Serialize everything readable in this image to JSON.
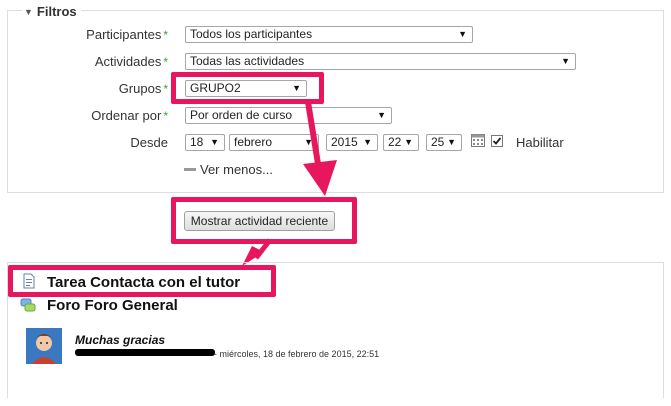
{
  "filters": {
    "legend": "Filtros",
    "participants_label": "Participantes",
    "participants_value": "Todos los participantes",
    "activities_label": "Actividades",
    "activities_value": "Todas las actividades",
    "groups_label": "Grupos",
    "groups_value": "GRUPO2",
    "order_label": "Ordenar por",
    "order_value": "Por orden de curso",
    "since_label": "Desde",
    "day": "18",
    "month": "febrero",
    "year": "2015",
    "hour": "22",
    "minute": "25",
    "enable_label": "Habilitar",
    "enable_checked": true,
    "show_less": "Ver menos...",
    "required_mark": "*"
  },
  "submit_label": "Mostrar actividad reciente",
  "activity": {
    "task_title": "Tarea Contacta con el tutor",
    "forum_title": "Foro Foro General",
    "post_subject": "Muchas gracias",
    "post_meta": "- miércoles, 18 de febrero de 2015, 22:51"
  },
  "colors": {
    "highlight": "#e8175d",
    "required": "#3c9d3c"
  }
}
